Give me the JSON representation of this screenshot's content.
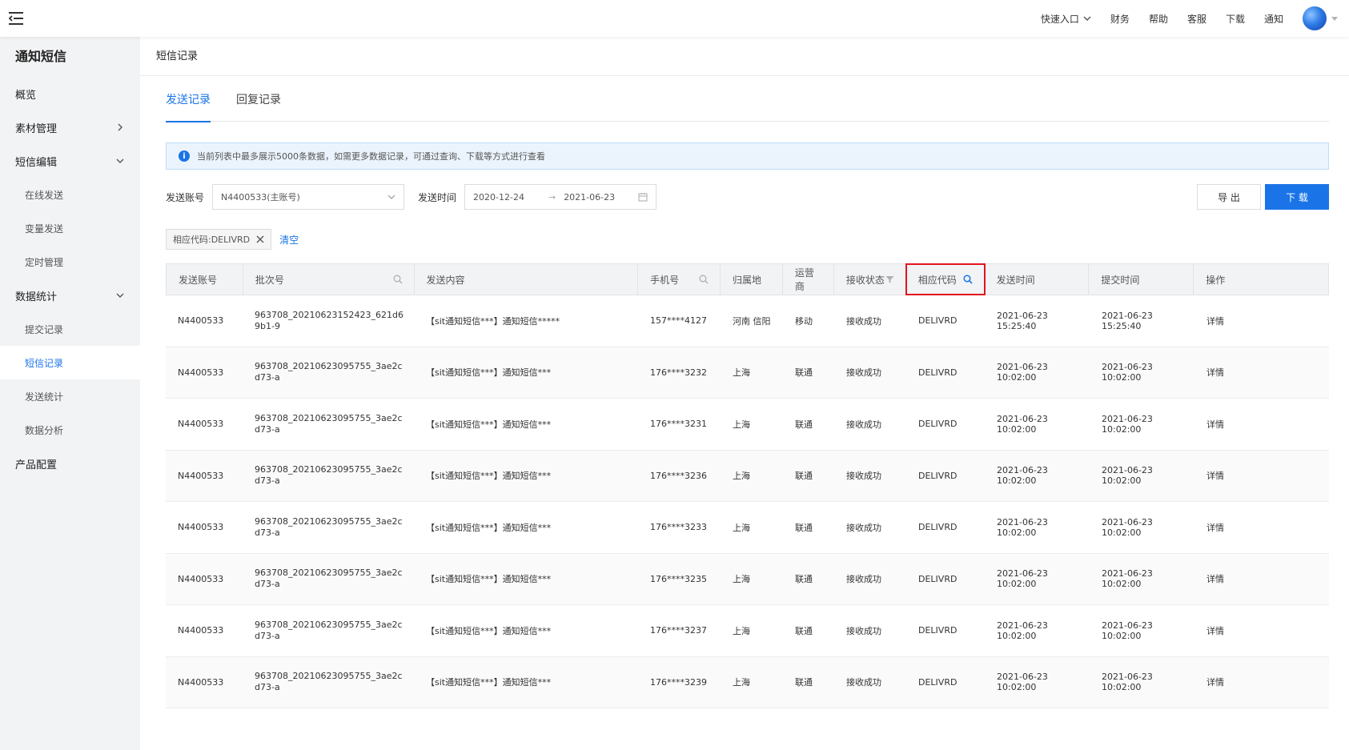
{
  "topbar": {
    "links": [
      "快速入口",
      "财务",
      "帮助",
      "客服",
      "下载",
      "通知"
    ]
  },
  "sidebar": {
    "title": "通知短信",
    "items": {
      "overview": "概览",
      "material": "素材管理",
      "sms_edit": "短信编辑",
      "online_send": "在线发送",
      "variable_send": "变量发送",
      "scheduled": "定时管理",
      "stats": "数据统计",
      "submit_records": "提交记录",
      "sms_records": "短信记录",
      "send_stats": "发送统计",
      "data_analysis": "数据分析",
      "product_config": "产品配置"
    }
  },
  "page": {
    "title": "短信记录",
    "tabs": [
      "发送记录",
      "回复记录"
    ],
    "notice": "当前列表中最多展示5000条数据，如需更多数据记录，可通过查询、下载等方式进行查看"
  },
  "filters": {
    "account_label": "发送账号",
    "account_value": "N4400533(主账号)",
    "time_label": "发送时间",
    "date_start": "2020-12-24",
    "date_end": "2021-06-23",
    "export_label": "导 出",
    "download_label": "下 载",
    "tag": "相应代码:DELIVRD",
    "clear_label": "清空"
  },
  "table": {
    "headers": [
      "发送账号",
      "批次号",
      "发送内容",
      "手机号",
      "归属地",
      "运营商",
      "接收状态",
      "相应代码",
      "发送时间",
      "提交时间",
      "操作"
    ],
    "rows": [
      [
        "N4400533",
        "963708_20210623152423_621d69b1-9",
        "【sit通知短信***】通知短信*****",
        "157****4127",
        "河南 信阳",
        "移动",
        "接收成功",
        "DELIVRD",
        "2021-06-23 15:25:40",
        "2021-06-23 15:25:40",
        "详情"
      ],
      [
        "N4400533",
        "963708_20210623095755_3ae2cd73-a",
        "【sit通知短信***】通知短信***",
        "176****3232",
        "上海",
        "联通",
        "接收成功",
        "DELIVRD",
        "2021-06-23 10:02:00",
        "2021-06-23 10:02:00",
        "详情"
      ],
      [
        "N4400533",
        "963708_20210623095755_3ae2cd73-a",
        "【sit通知短信***】通知短信***",
        "176****3231",
        "上海",
        "联通",
        "接收成功",
        "DELIVRD",
        "2021-06-23 10:02:00",
        "2021-06-23 10:02:00",
        "详情"
      ],
      [
        "N4400533",
        "963708_20210623095755_3ae2cd73-a",
        "【sit通知短信***】通知短信***",
        "176****3236",
        "上海",
        "联通",
        "接收成功",
        "DELIVRD",
        "2021-06-23 10:02:00",
        "2021-06-23 10:02:00",
        "详情"
      ],
      [
        "N4400533",
        "963708_20210623095755_3ae2cd73-a",
        "【sit通知短信***】通知短信***",
        "176****3233",
        "上海",
        "联通",
        "接收成功",
        "DELIVRD",
        "2021-06-23 10:02:00",
        "2021-06-23 10:02:00",
        "详情"
      ],
      [
        "N4400533",
        "963708_20210623095755_3ae2cd73-a",
        "【sit通知短信***】通知短信***",
        "176****3235",
        "上海",
        "联通",
        "接收成功",
        "DELIVRD",
        "2021-06-23 10:02:00",
        "2021-06-23 10:02:00",
        "详情"
      ],
      [
        "N4400533",
        "963708_20210623095755_3ae2cd73-a",
        "【sit通知短信***】通知短信***",
        "176****3237",
        "上海",
        "联通",
        "接收成功",
        "DELIVRD",
        "2021-06-23 10:02:00",
        "2021-06-23 10:02:00",
        "详情"
      ],
      [
        "N4400533",
        "963708_20210623095755_3ae2cd73-a",
        "【sit通知短信***】通知短信***",
        "176****3239",
        "上海",
        "联通",
        "接收成功",
        "DELIVRD",
        "2021-06-23 10:02:00",
        "2021-06-23 10:02:00",
        "详情"
      ]
    ]
  },
  "colors": {
    "accent": "#1a74e8",
    "highlight_box": "#e0141e",
    "sidebar_bg": "#f2f3f5"
  }
}
